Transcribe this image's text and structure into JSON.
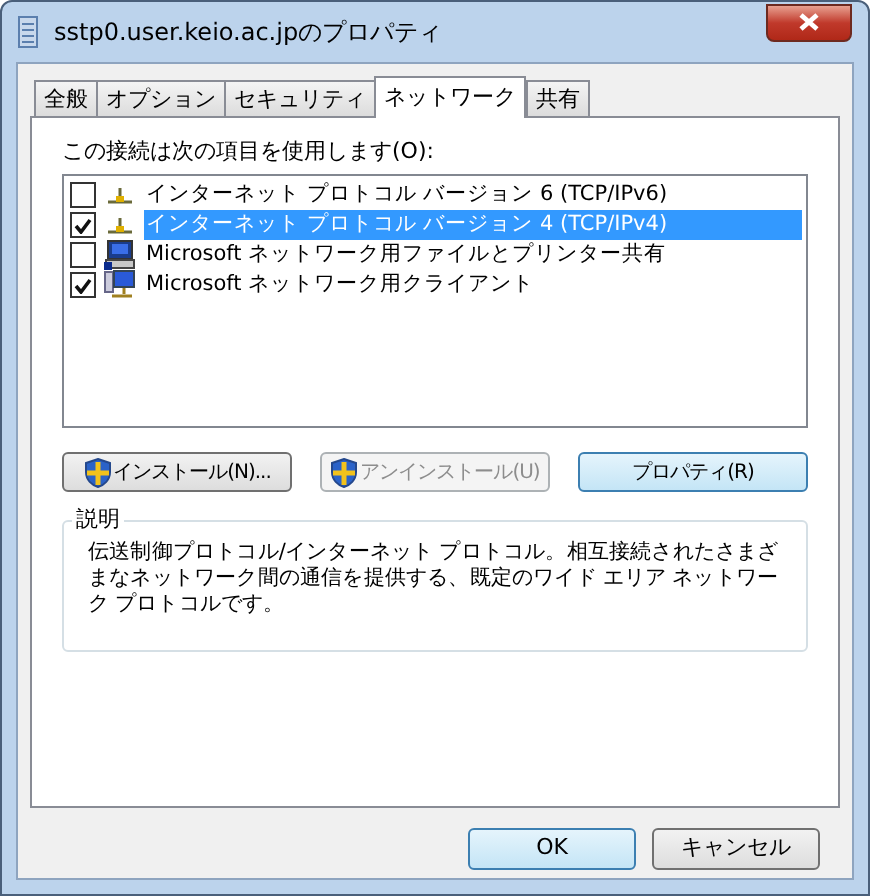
{
  "window": {
    "title": "sstp0.user.keio.ac.jpのプロパティ"
  },
  "tabs": [
    {
      "label": "全般",
      "selected": false
    },
    {
      "label": "オプション",
      "selected": false
    },
    {
      "label": "セキュリティ",
      "selected": false
    },
    {
      "label": "ネットワーク",
      "selected": true
    },
    {
      "label": "共有",
      "selected": false
    }
  ],
  "items_label": "この接続は次の項目を使用します(O):",
  "items": [
    {
      "label": "インターネット プロトコル バージョン 6 (TCP/IPv6)",
      "kind": "protocol",
      "checked": false,
      "selected": false
    },
    {
      "label": "インターネット プロトコル バージョン 4 (TCP/IPv4)",
      "kind": "protocol",
      "checked": true,
      "selected": true
    },
    {
      "label": "Microsoft ネットワーク用ファイルとプリンター共有",
      "kind": "service",
      "checked": false,
      "selected": false
    },
    {
      "label": "Microsoft ネットワーク用クライアント",
      "kind": "client",
      "checked": true,
      "selected": false
    }
  ],
  "item_buttons": [
    {
      "label": "インストール(N)...",
      "shield": true,
      "disabled": false,
      "default": false
    },
    {
      "label": "アンインストール(U)",
      "shield": true,
      "disabled": true,
      "default": false
    },
    {
      "label": "プロパティ(R)",
      "shield": false,
      "disabled": false,
      "default": true
    }
  ],
  "description": {
    "title": "説明",
    "text": "伝送制御プロトコル/インターネット プロトコル。相互接続されたさまざまなネットワーク間の通信を提供する、既定のワイド エリア ネットワーク プロトコルです。"
  },
  "buttons": [
    {
      "label": "OK",
      "default": true
    },
    {
      "label": "キャンセル",
      "default": false
    }
  ]
}
